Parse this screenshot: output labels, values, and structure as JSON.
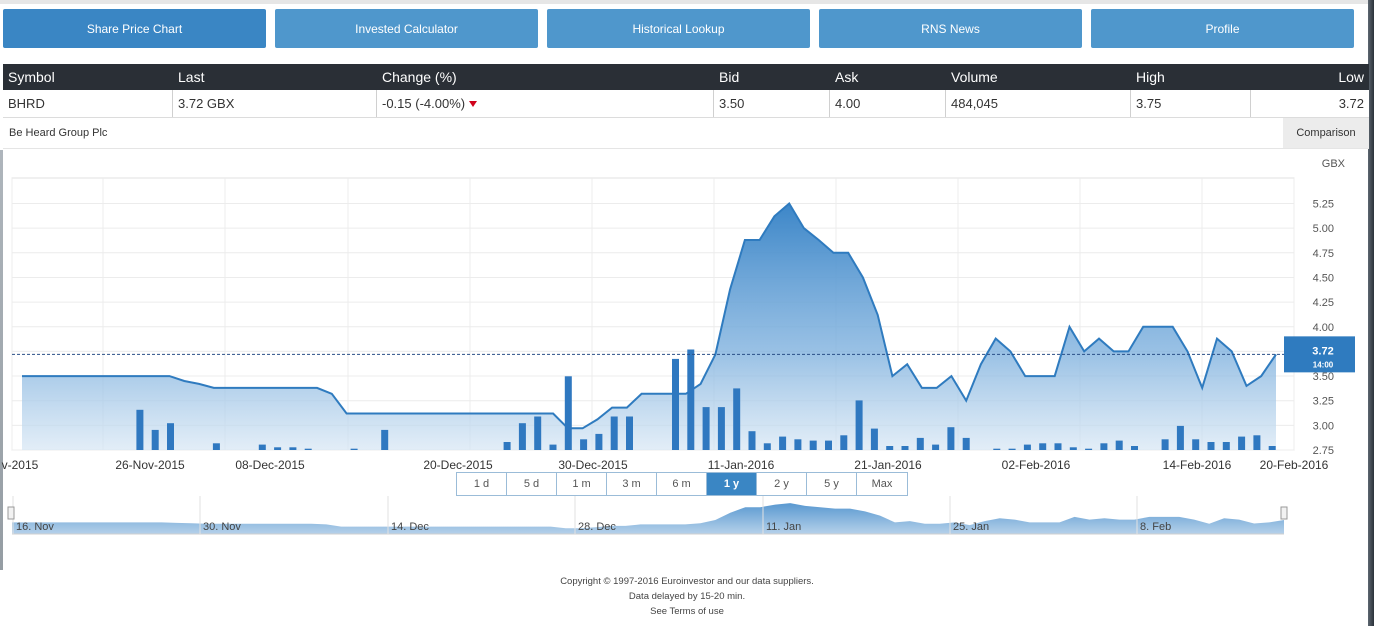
{
  "tabs": [
    {
      "label": "Share Price Chart",
      "active": true
    },
    {
      "label": "Invested Calculator",
      "active": false
    },
    {
      "label": "Historical Lookup",
      "active": false
    },
    {
      "label": "RNS News",
      "active": false
    },
    {
      "label": "Profile",
      "active": false
    }
  ],
  "quote": {
    "headers": {
      "symbol": "Symbol",
      "last": "Last",
      "change": "Change (%)",
      "bid": "Bid",
      "ask": "Ask",
      "volume": "Volume",
      "high": "High",
      "low": "Low"
    },
    "values": {
      "symbol": "BHRD",
      "last": "3.72 GBX",
      "change": "-0.15 (-4.00%)",
      "bid": "3.50",
      "ask": "4.00",
      "volume": "484,045",
      "high": "3.75",
      "low": "3.72"
    }
  },
  "company_name": "Be Heard Group Plc",
  "comparison_label": "Comparison",
  "chart_data": {
    "type": "area",
    "currency_label": "GBX",
    "y_ticks": [
      "2.75",
      "3.00",
      "3.25",
      "3.50",
      "3.75",
      "4.00",
      "4.25",
      "4.50",
      "4.75",
      "5.00",
      "5.25"
    ],
    "ylim": [
      2.75,
      5.45
    ],
    "x_labels": [
      "v-2015",
      "26-Nov-2015",
      "08-Dec-2015",
      "20-Dec-2015",
      "30-Dec-2015",
      "11-Jan-2016",
      "21-Jan-2016",
      "02-Feb-2016",
      "14-Feb-2016",
      "20-Feb-2016"
    ],
    "price": [
      3.5,
      3.5,
      3.5,
      3.5,
      3.5,
      3.5,
      3.5,
      3.5,
      3.5,
      3.5,
      3.5,
      3.45,
      3.42,
      3.38,
      3.38,
      3.38,
      3.38,
      3.38,
      3.38,
      3.38,
      3.38,
      3.32,
      3.12,
      3.12,
      3.12,
      3.12,
      3.12,
      3.12,
      3.12,
      3.12,
      3.12,
      3.12,
      3.12,
      3.12,
      3.12,
      3.12,
      3.12,
      2.97,
      2.97,
      3.06,
      3.18,
      3.18,
      3.32,
      3.32,
      3.32,
      3.32,
      3.42,
      3.72,
      4.38,
      4.88,
      4.88,
      5.12,
      5.25,
      5.0,
      4.88,
      4.75,
      4.75,
      4.5,
      4.12,
      3.5,
      3.62,
      3.38,
      3.38,
      3.5,
      3.25,
      3.62,
      3.88,
      3.75,
      3.5,
      3.5,
      3.5,
      4.0,
      3.75,
      3.88,
      3.75,
      3.75,
      4.0,
      4.0,
      4.0,
      3.75,
      3.38,
      3.88,
      3.75,
      3.4,
      3.5,
      3.72
    ],
    "volume": [
      0,
      0,
      0,
      0,
      0,
      0,
      0,
      0,
      0.3,
      0.15,
      0.2,
      0,
      0,
      0.05,
      0,
      0,
      0.04,
      0.02,
      0.02,
      0.01,
      0,
      0,
      0.01,
      0,
      0.15,
      0,
      0,
      0,
      0,
      0,
      0,
      0,
      0.06,
      0.2,
      0.25,
      0.04,
      0.55,
      0.08,
      0.12,
      0.25,
      0.25,
      0,
      0,
      0.68,
      0.75,
      0.32,
      0.32,
      0.46,
      0.14,
      0.05,
      0.1,
      0.08,
      0.07,
      0.07,
      0.11,
      0.37,
      0.16,
      0.03,
      0.03,
      0.09,
      0.04,
      0.17,
      0.09,
      0,
      0.01,
      0.01,
      0.04,
      0.05,
      0.05,
      0.02,
      0.01,
      0.05,
      0.07,
      0.03,
      0,
      0.08,
      0.18,
      0.08,
      0.06,
      0.06,
      0.1,
      0.11,
      0.03
    ],
    "current_value": "3.72",
    "current_time": "14:00",
    "navigator_labels": [
      "16. Nov",
      "30. Nov",
      "14. Dec",
      "28. Dec",
      "11. Jan",
      "25. Jan",
      "8. Feb"
    ]
  },
  "ranges": [
    {
      "label": "1 d",
      "active": false
    },
    {
      "label": "5 d",
      "active": false
    },
    {
      "label": "1 m",
      "active": false
    },
    {
      "label": "3 m",
      "active": false
    },
    {
      "label": "6 m",
      "active": false
    },
    {
      "label": "1 y",
      "active": true
    },
    {
      "label": "2 y",
      "active": false
    },
    {
      "label": "5 y",
      "active": false
    },
    {
      "label": "Max",
      "active": false
    }
  ],
  "footer": {
    "copyright": "Copyright © 1997-2016 Euroinvestor and our data suppliers.",
    "delay": "Data delayed by 15-20 min.",
    "terms": "See Terms of use"
  },
  "colors": {
    "accent": "#3a86c4",
    "tab": "#4f97cc",
    "header_bg": "#2a2f36",
    "down": "#d0021b"
  }
}
